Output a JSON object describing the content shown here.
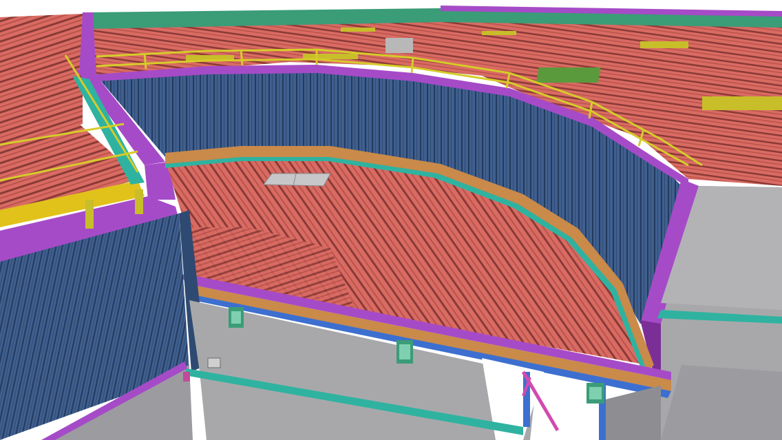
{
  "viewport": {
    "title": "",
    "description_visible_text": []
  },
  "colors": {
    "roof_red": "#d96b63",
    "roof_red_dark": "#b9534c",
    "roof_line": "#8a3a36",
    "wall_blue": "#3f5f8f",
    "wall_blue_dark": "#2f4a72",
    "wall_line": "#243a5c",
    "parapet_purple": "#a64bc7",
    "purple_dark": "#7b2f96",
    "teal": "#2fb3a0",
    "green_teal": "#3b9c78",
    "yellow_rail": "#d6cc2a",
    "yellow_band": "#e1c21b",
    "beam_orange": "#c98a4a",
    "concrete_gray": "#a8a8ab",
    "concrete_light": "#c7c7ca",
    "skylight_gray": "#b8b8b8",
    "sky_white": "#ffffff",
    "steel_pink": "#d24ab0",
    "steel_blue": "#3c6fd0"
  },
  "icons": {
    "skylight": "skylight-panel",
    "bracket": "steel-bracket"
  }
}
